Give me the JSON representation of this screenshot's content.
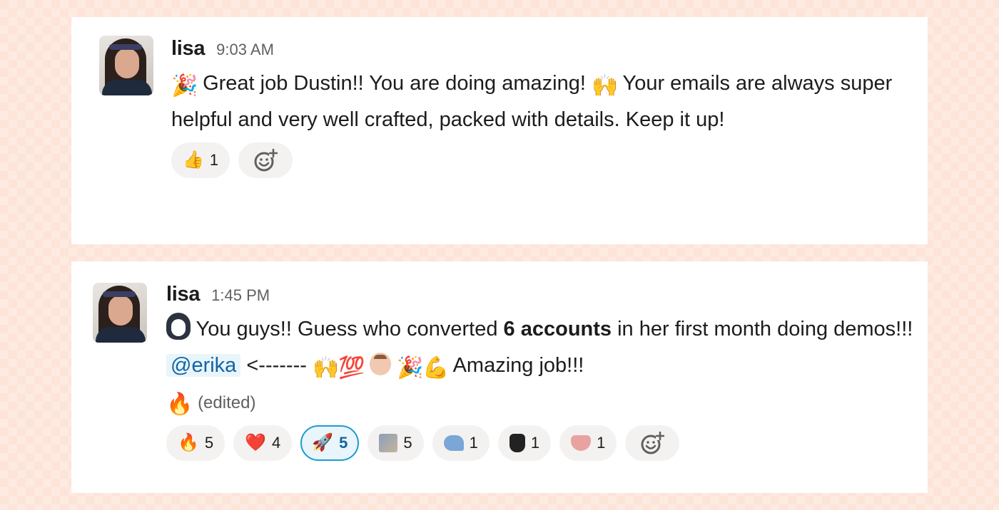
{
  "messages": [
    {
      "username": "lisa",
      "time": "9:03 AM",
      "text": {
        "emoji_party": "🎉",
        "part1": "Great job Dustin!! You are doing amazing!",
        "emoji_raised_hands": "🙌",
        "part2": "Your emails are always super helpful and very well crafted, packed with details. Keep it up!"
      },
      "reactions": [
        {
          "emoji": "👍",
          "icon": "thumbs-up-icon",
          "count": "1",
          "active": false
        }
      ]
    },
    {
      "username": "lisa",
      "time": "1:45 PM",
      "text": {
        "emoji_penguin_icon": "penguin-icon",
        "part1": "You guys!! Guess who converted",
        "bold": "6  accounts",
        "part2": "in her first month doing demos!!!",
        "mention": "@erika",
        "part3": "<-------",
        "emoji_raised_hands": "🙌",
        "emoji_100": "💯",
        "emoji_party": "🎉",
        "emoji_muscle": "💪",
        "part4": "Amazing job!!!",
        "emoji_fire": "🔥",
        "edited": "(edited)"
      },
      "reactions": [
        {
          "emoji": "🔥",
          "icon": "fire-icon",
          "count": "5",
          "active": false
        },
        {
          "emoji": "❤️",
          "icon": "heart-icon",
          "count": "4",
          "active": false
        },
        {
          "emoji": "🚀",
          "icon": "rocket-icon",
          "count": "5",
          "active": true
        },
        {
          "emoji": "",
          "icon": "custom-photo-icon",
          "count": "5",
          "active": false
        },
        {
          "emoji": "",
          "icon": "blue-bird-icon",
          "count": "1",
          "active": false
        },
        {
          "emoji": "",
          "icon": "black-cat-icon",
          "count": "1",
          "active": false
        },
        {
          "emoji": "",
          "icon": "pig-snout-icon",
          "count": "1",
          "active": false
        }
      ]
    }
  ],
  "colors": {
    "background": "#fde4d8",
    "card": "#ffffff",
    "mention_bg": "#e8f5fa",
    "mention_text": "#1264a3",
    "active_reaction_border": "#1d9bd1"
  }
}
